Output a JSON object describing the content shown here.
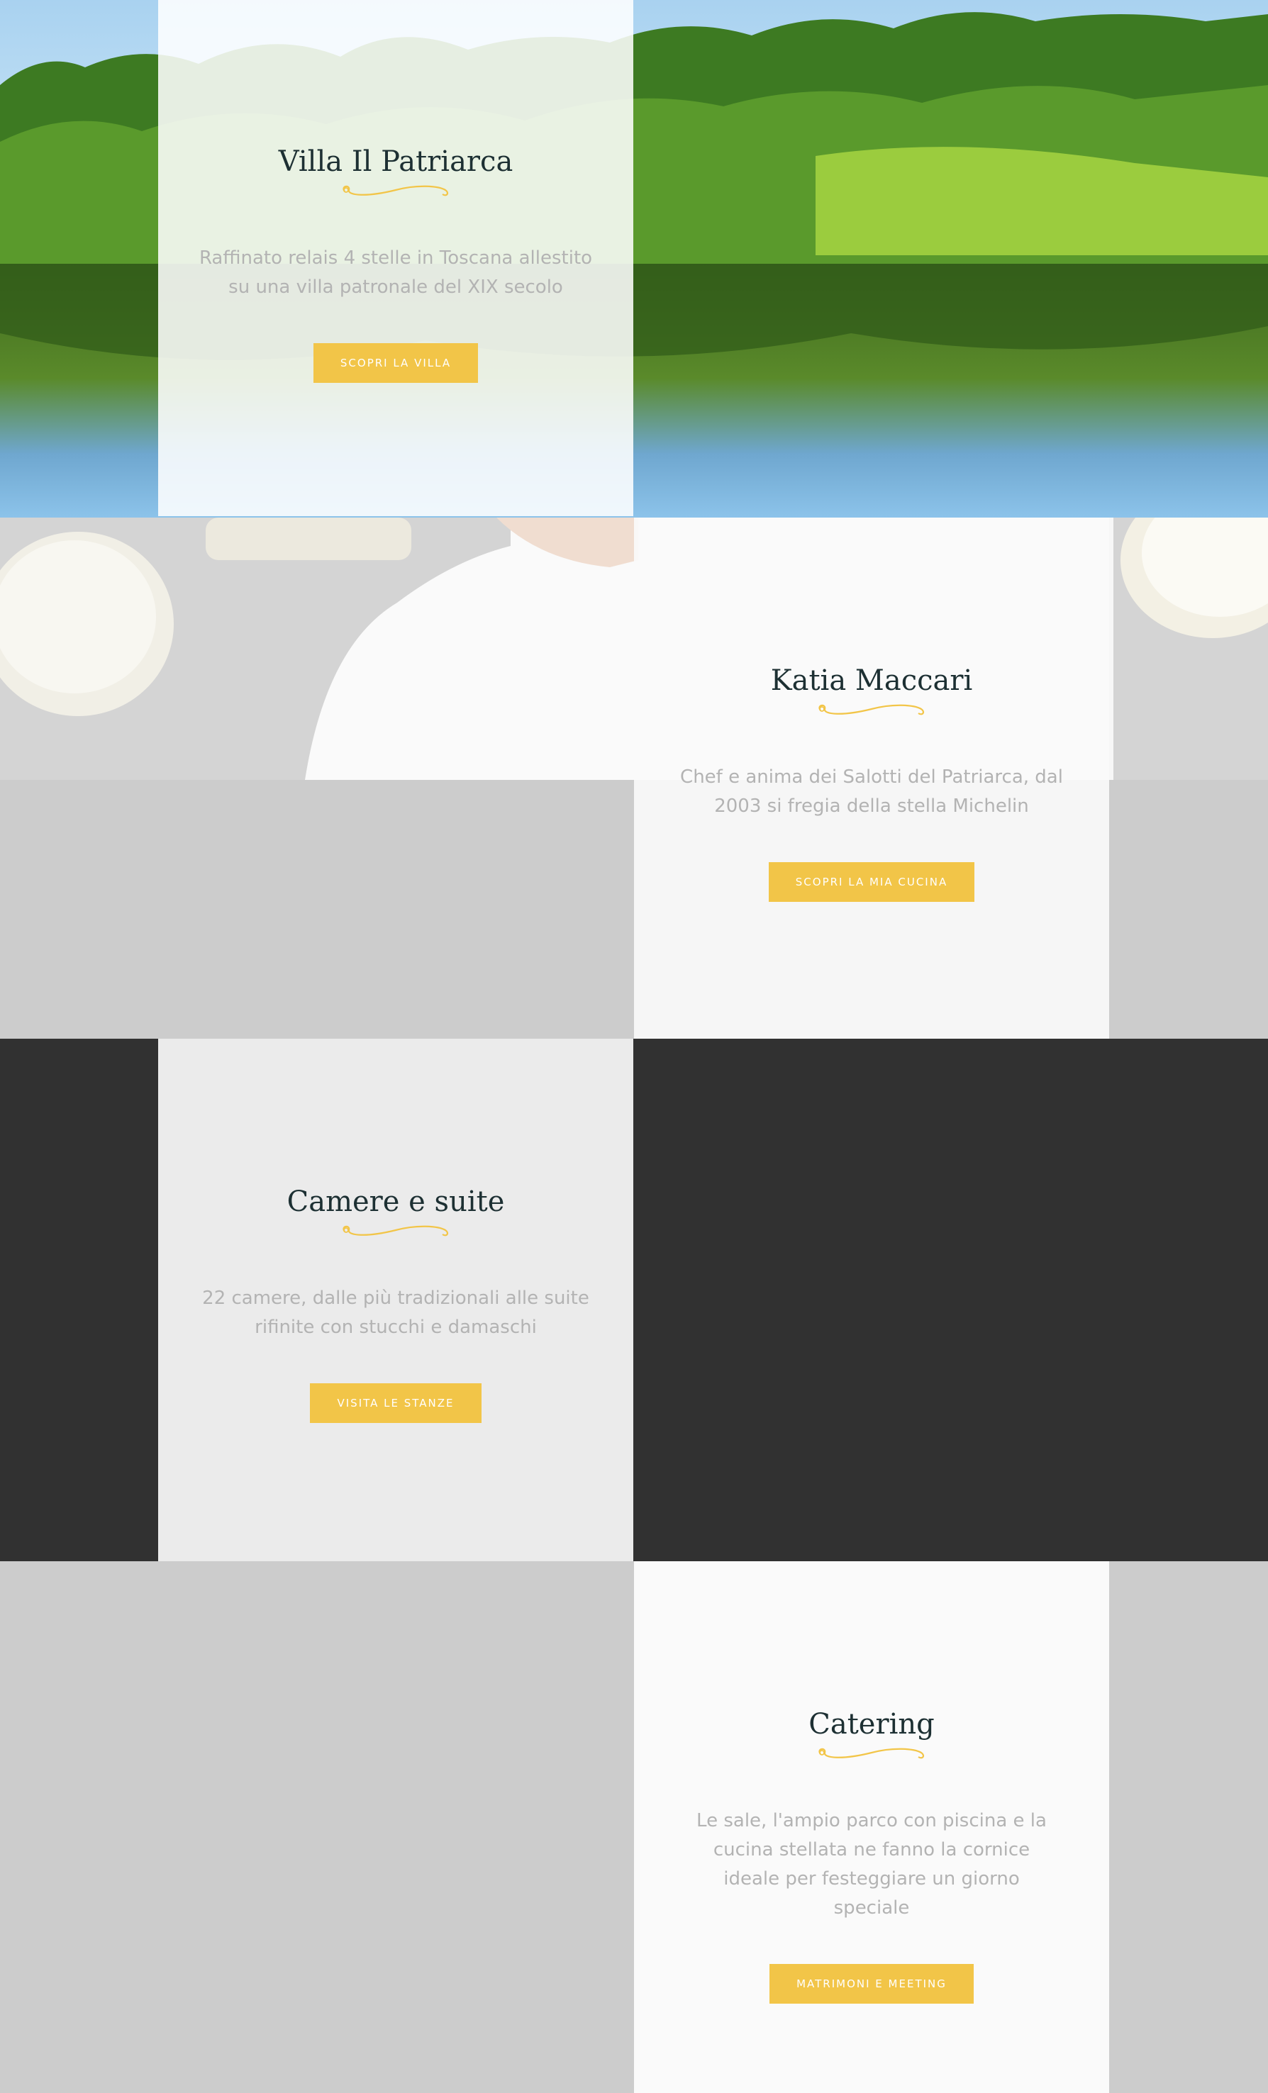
{
  "sections": [
    {
      "title": "Villa Il Patriarca",
      "text": "Raffinato relais 4 stelle in Toscana allestito su una villa patronale del XIX secolo",
      "button": "SCOPRI LA VILLA",
      "image": "lake-landscape"
    },
    {
      "title": "Katia Maccari",
      "text": "Chef e anima dei Salotti del Patriarca, dal 2003 si fregia della stella Michelin",
      "button": "SCOPRI LA MIA CUCINA",
      "image": "chef-portrait"
    },
    {
      "title": "Camere e suite",
      "text": "22 camere, dalle più tradizionali alle suite rifinite con stucchi e damaschi",
      "button": "VISITA LE STANZE"
    },
    {
      "title": "Catering",
      "text": "Le sale, l'ampio parco con piscina e la cucina stellata ne fanno la cornice ideale per festeggiare un giorno speciale",
      "button": "MATRIMONI E MEETING"
    }
  ],
  "colors": {
    "accent": "#f2c548",
    "title": "#1d3033",
    "text": "#b3b3b3",
    "dark_bg": "#313131",
    "gray_bg": "#cccccc"
  }
}
